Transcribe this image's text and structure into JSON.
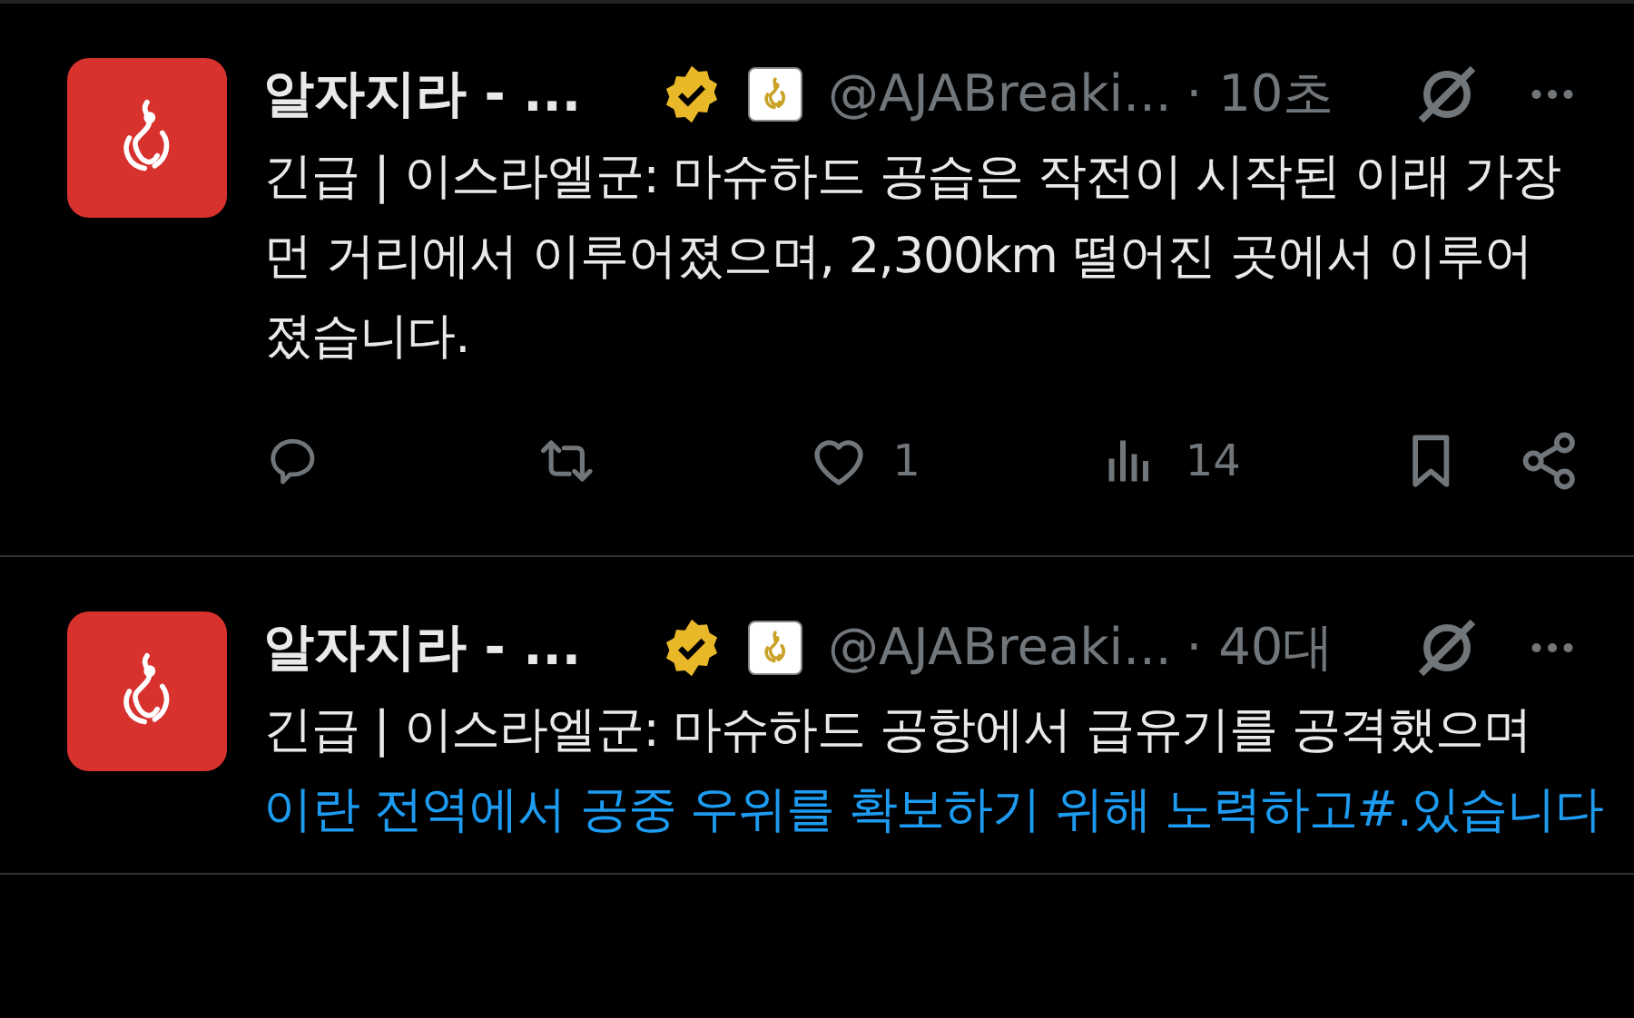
{
  "tweets": [
    {
      "name": "알자지라 - ...",
      "handle": "@AJABreaki...",
      "time": "· 10초",
      "body": [
        {
          "kind": "plain",
          "text": "긴급 | 이스라엘군: 마슈하드 공습은 작전이 시작된 이래 가장 먼 거리에서 이루어졌으며, 2,300km 떨어진 곳에서 이루어졌습니다."
        }
      ],
      "actions": {
        "likes": "1",
        "views": "14"
      }
    },
    {
      "name": "알자지라 - ...",
      "handle": "@AJABreaki...",
      "time": "· 40대",
      "body": [
        {
          "kind": "plain",
          "text": "긴급 | 이스라엘군: 마슈하드 공항에서 급유기를 공격했으며 "
        },
        {
          "kind": "link",
          "text": "이란 전역에서 공중 우위를 확보하기 위해 노력하고#"
        },
        {
          "kind": "link",
          "text": ".있습니다"
        }
      ]
    }
  ]
}
